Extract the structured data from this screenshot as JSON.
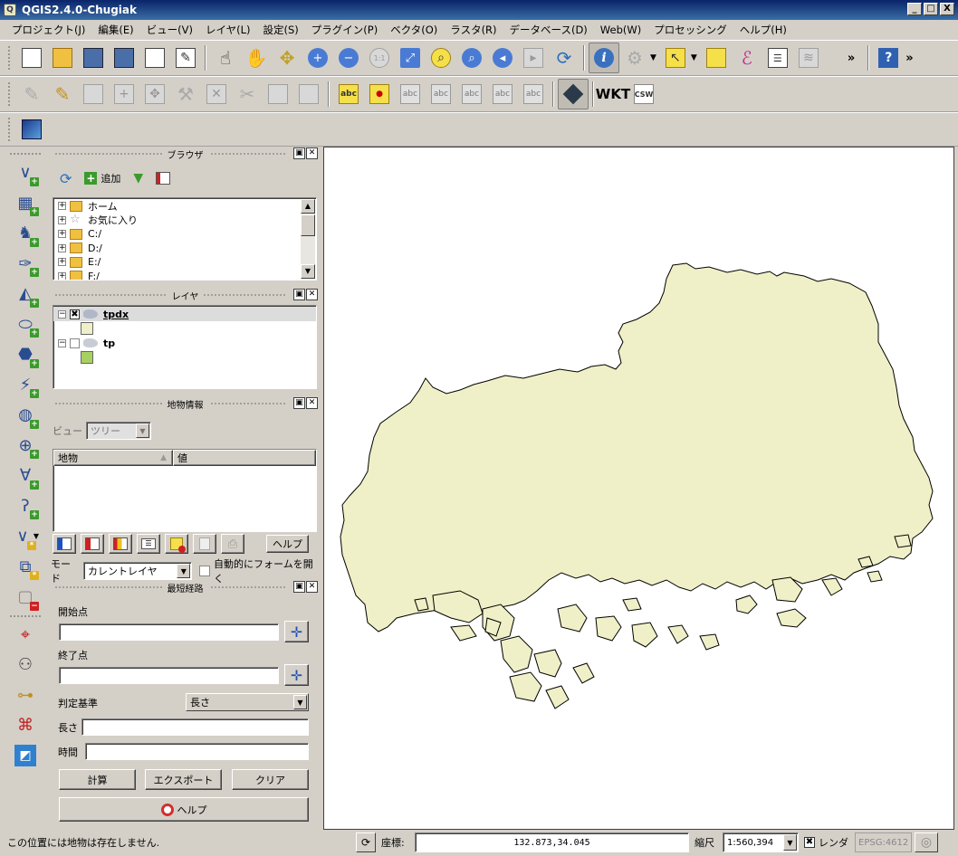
{
  "window": {
    "title": "QGIS2.4.0-Chugiak",
    "min": "_",
    "max": "□",
    "close": "X"
  },
  "menu": [
    "プロジェクト(J)",
    "編集(E)",
    "ビュー(V)",
    "レイヤ(L)",
    "設定(S)",
    "プラグイン(P)",
    "ベクタ(O)",
    "ラスタ(R)",
    "データベース(D)",
    "Web(W)",
    "プロセッシング",
    "ヘルプ(H)"
  ],
  "toolbar": {
    "overflow": "»",
    "abc": "abc",
    "wkt": "WKT",
    "csw": "CSW"
  },
  "browser": {
    "title": "ブラウザ",
    "add_label": "追加",
    "items": [
      {
        "label": "ホーム"
      },
      {
        "label": "お気に入り"
      },
      {
        "label": "C:/"
      },
      {
        "label": "D:/"
      },
      {
        "label": "E:/"
      },
      {
        "label": "F:/"
      }
    ]
  },
  "layers": {
    "title": "レイヤ",
    "items": [
      {
        "name": "tpdx",
        "checked": true,
        "color": "#f0f0c8"
      },
      {
        "name": "tp",
        "checked": false,
        "color": "#a8d060"
      }
    ]
  },
  "feature_info": {
    "title": "地物情報",
    "view_label": "ビュー",
    "view_value": "ツリー",
    "col_feature": "地物",
    "col_value": "値",
    "help_label": "ヘルプ",
    "mode_label": "モード",
    "mode_value": "カレントレイヤ",
    "auto_open_label": "自動的にフォームを開く"
  },
  "shortest_path": {
    "title": "最短経路",
    "start_label": "開始点",
    "end_label": "終了点",
    "criterion_label": "判定基準",
    "criterion_value": "長さ",
    "length_label": "長さ",
    "time_label": "時間",
    "calc_label": "計算",
    "export_label": "エクスポート",
    "clear_label": "クリア",
    "help_label": "ヘルプ"
  },
  "status": {
    "message": "この位置には地物は存在しません.",
    "coord_label": "座標:",
    "coord_value": "132.873,34.045",
    "scale_label": "縮尺",
    "scale_value": "1:560,394",
    "render_label": "レンダ",
    "crs": "EPSG:4612"
  },
  "colors": {
    "polygon_fill": "#f0f0c8",
    "polygon_stroke": "#000000"
  }
}
